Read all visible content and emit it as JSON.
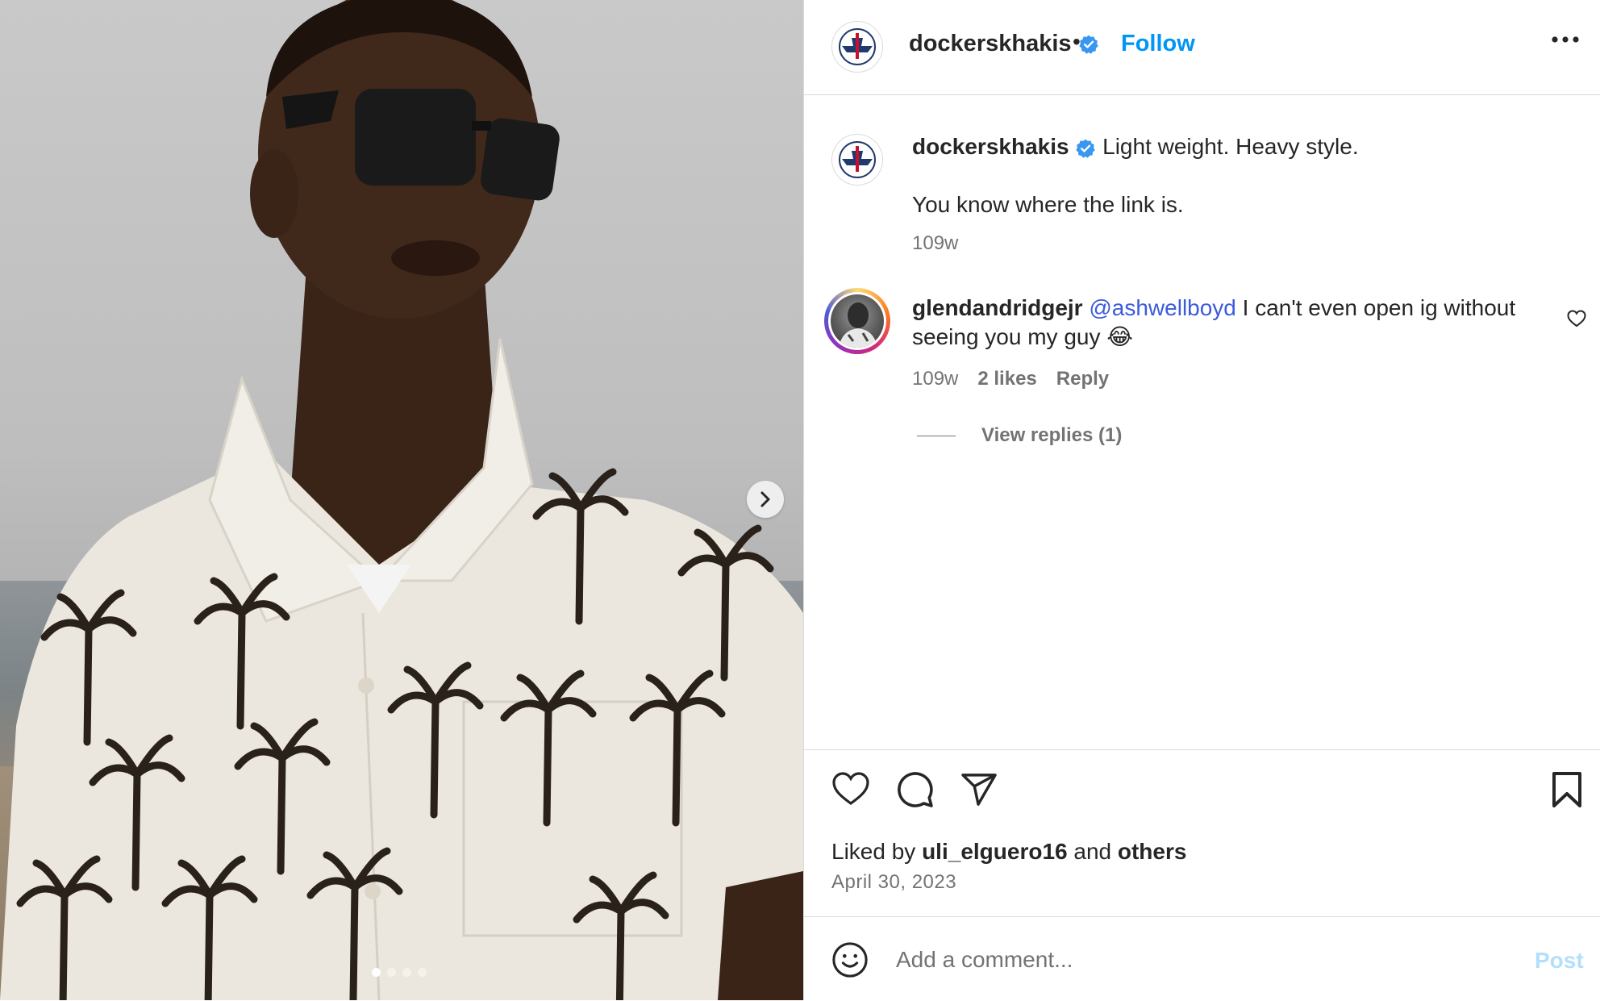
{
  "colors": {
    "accent": "#0095f6",
    "verified": "#3897f0",
    "mention": "#3b5bdb",
    "muted": "#737373",
    "post_disabled": "#b2dffc"
  },
  "icons": {
    "next": "chevron-right-icon",
    "more": "more-horizontal-icon",
    "like": "heart-icon",
    "comment": "comment-icon",
    "share": "paper-plane-icon",
    "save": "bookmark-icon",
    "emoji": "smiley-icon",
    "verified": "verified-badge-icon"
  },
  "carousel": {
    "slide_count": 4,
    "active_index": 0
  },
  "header": {
    "username": "dockerskhakis",
    "separator": "•",
    "follow_label": "Follow"
  },
  "caption": {
    "username": "dockerskhakis",
    "line1": "Light weight. Heavy style.",
    "line2": "You know where the link is.",
    "time": "109w"
  },
  "comments": [
    {
      "username": "glendandridgejr",
      "mention": "@ashwellboyd",
      "text": "I can't even open ig without seeing you my guy 😂",
      "time": "109w",
      "likes": "2 likes",
      "reply_label": "Reply",
      "view_replies": "View replies (1)"
    }
  ],
  "likes": {
    "prefix": "Liked by",
    "user": "uli_elguero16",
    "middle": "and",
    "others": "others"
  },
  "post_date": "April 30, 2023",
  "composer": {
    "placeholder": "Add a comment...",
    "post_label": "Post"
  }
}
